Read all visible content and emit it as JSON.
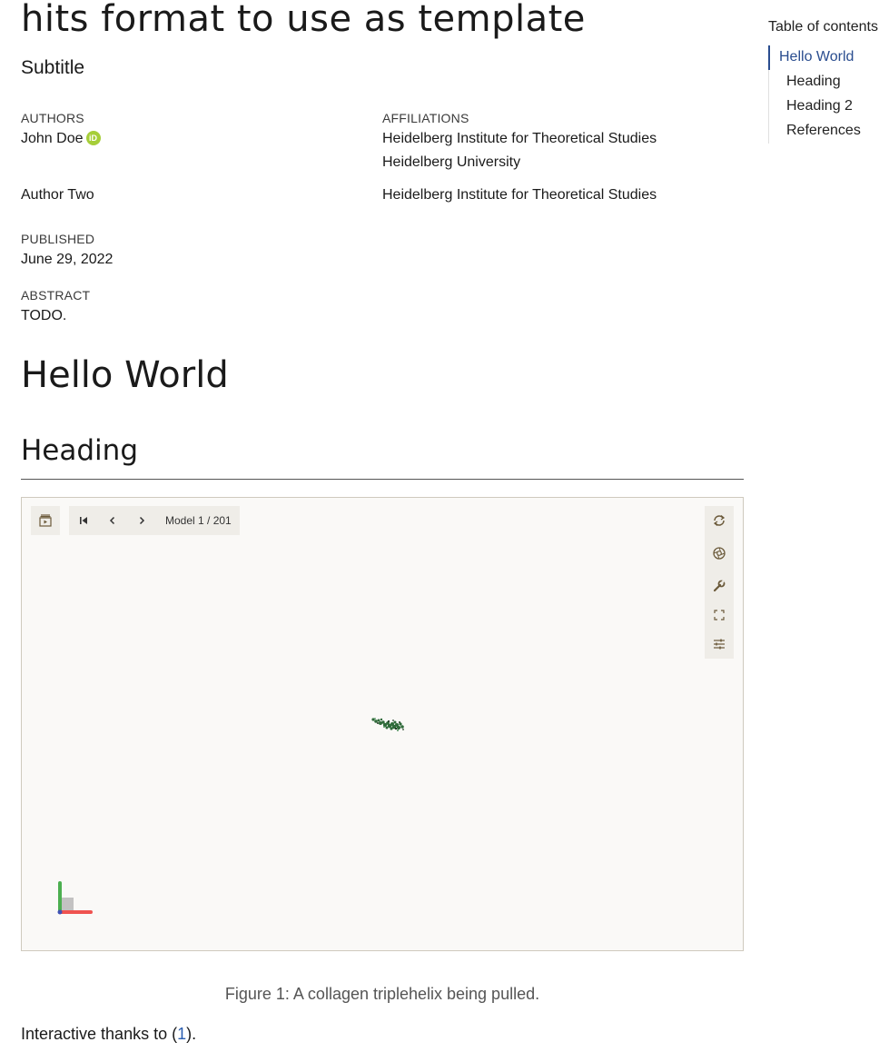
{
  "header": {
    "title": "hits format to use as template",
    "subtitle": "Subtitle"
  },
  "meta": {
    "authors_label": "AUTHORS",
    "affiliations_label": "AFFILIATIONS",
    "authors": [
      {
        "name": "John Doe",
        "orcid_badge": "iD",
        "affiliations": [
          "Heidelberg Institute for Theoretical Studies",
          "Heidelberg University"
        ]
      },
      {
        "name": "Author Two",
        "affiliations": [
          "Heidelberg Institute for Theoretical Studies"
        ]
      }
    ],
    "published_label": "PUBLISHED",
    "published_date": "June 29, 2022",
    "abstract_label": "ABSTRACT",
    "abstract_text": "TODO."
  },
  "content": {
    "h1": "Hello World",
    "h2": "Heading",
    "viewer": {
      "model_label": "Model 1 / 201",
      "icons": [
        "animation-icon",
        "first-model-icon",
        "previous-icon",
        "next-icon",
        "reset-icon",
        "screenshot-icon",
        "wrench-icon",
        "fullscreen-icon",
        "settings-icon"
      ]
    },
    "caption": "Figure 1: A collagen triplehelix being pulled.",
    "paragraph_before": "Interactive thanks to (",
    "paragraph_link": "1",
    "paragraph_after": ")."
  },
  "toc": {
    "title": "Table of contents",
    "items": [
      "Hello World",
      "Heading",
      "Heading 2",
      "References"
    ],
    "active_item": "Hello World"
  },
  "colors": {
    "link": "#2a5db0",
    "toc_active": "#2a4d8f",
    "orcid": "#a6ce39",
    "viewer_background": "#faf9f7"
  }
}
